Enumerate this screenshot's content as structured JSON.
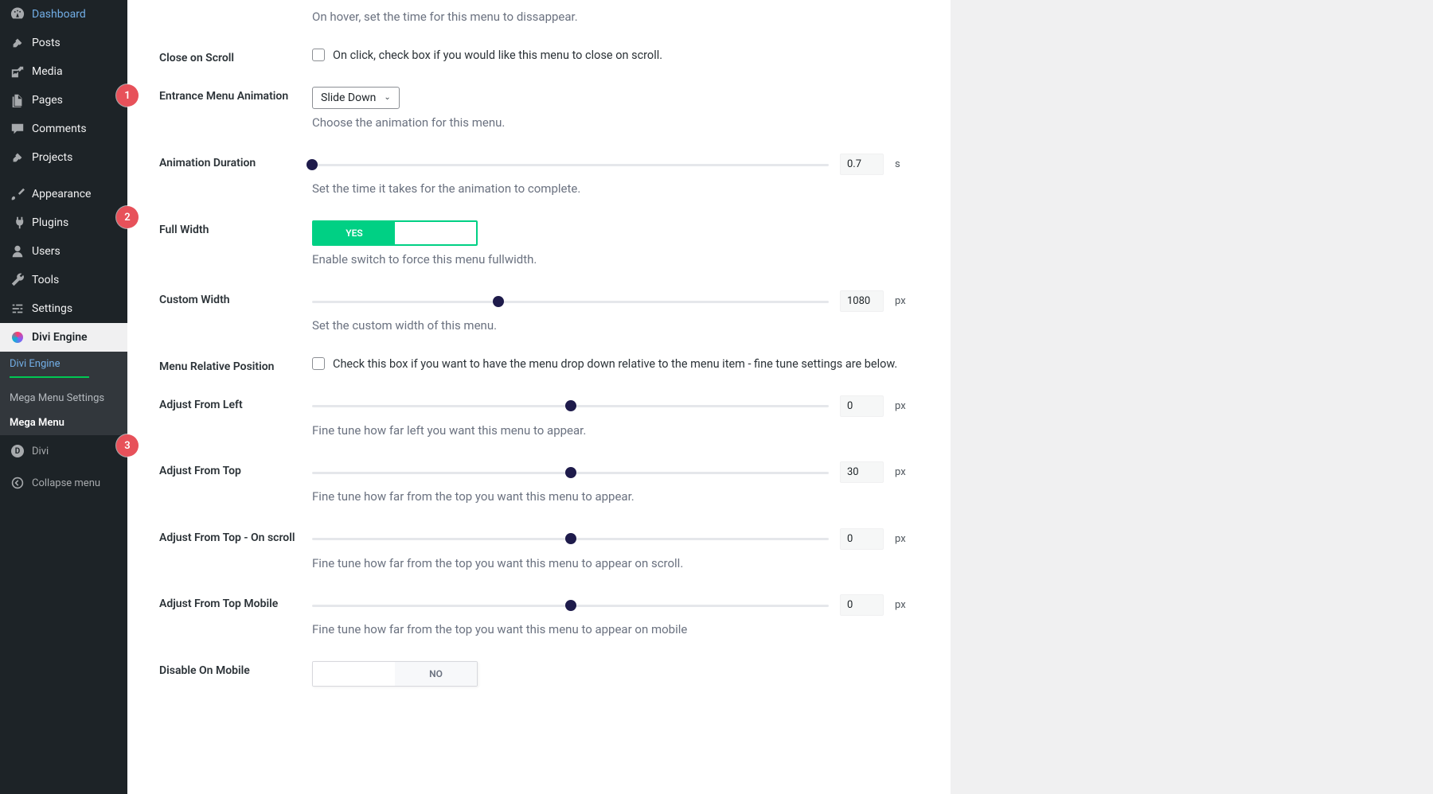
{
  "sidebar": {
    "dashboard": "Dashboard",
    "posts": "Posts",
    "media": "Media",
    "pages": "Pages",
    "comments": "Comments",
    "projects": "Projects",
    "appearance": "Appearance",
    "plugins": "Plugins",
    "users": "Users",
    "tools": "Tools",
    "settings": "Settings",
    "divi_engine": "Divi Engine",
    "sub_divi_engine": "Divi Engine",
    "sub_mega_menu_settings": "Mega Menu Settings",
    "sub_mega_menu": "Mega Menu",
    "divi": "Divi",
    "collapse": "Collapse menu"
  },
  "labels": {
    "close_on_scroll": "Close on Scroll",
    "entrance_animation": "Entrance Menu Animation",
    "animation_duration": "Animation Duration",
    "full_width": "Full Width",
    "custom_width": "Custom Width",
    "menu_relative": "Menu Relative Position",
    "adjust_left": "Adjust From Left",
    "adjust_top": "Adjust From Top",
    "adjust_top_scroll": "Adjust From Top - On scroll",
    "adjust_top_mobile": "Adjust From Top Mobile",
    "disable_mobile": "Disable On Mobile"
  },
  "help": {
    "hover_time": "On hover, set the time for this menu to dissappear.",
    "close_on_scroll": "On click, check box if you would like this menu to close on scroll.",
    "entrance_animation": "Choose the animation for this menu.",
    "animation_duration": "Set the time it takes for the animation to complete.",
    "full_width": "Enable switch to force this menu fullwidth.",
    "custom_width": "Set the custom width of this menu.",
    "menu_relative": "Check this box if you want to have the menu drop down relative to the menu item - fine tune settings are below.",
    "adjust_left": "Fine tune how far left you want this menu to appear.",
    "adjust_top": "Fine tune how far from the top you want this menu to appear.",
    "adjust_top_scroll": "Fine tune how far from the top you want this menu to appear on scroll.",
    "adjust_top_mobile": "Fine tune how far from the top you want this menu to appear on mobile"
  },
  "values": {
    "entrance_animation": "Slide Down",
    "animation_duration": {
      "val": "0.7",
      "unit": "s"
    },
    "full_width": "YES",
    "custom_width": {
      "val": "1080",
      "unit": "px"
    },
    "adjust_left": {
      "val": "0",
      "unit": "px"
    },
    "adjust_top": {
      "val": "30",
      "unit": "px"
    },
    "adjust_top_scroll": {
      "val": "0",
      "unit": "px"
    },
    "adjust_top_mobile": {
      "val": "0",
      "unit": "px"
    },
    "disable_mobile": "NO"
  },
  "callouts": {
    "c1": "1",
    "c2": "2",
    "c3": "3"
  },
  "slider_positions": {
    "animation_duration": "14%",
    "custom_width": "36%",
    "adjust_left": "50%",
    "adjust_top": "50%",
    "adjust_top_scroll": "50%",
    "adjust_top_mobile": "50%"
  }
}
